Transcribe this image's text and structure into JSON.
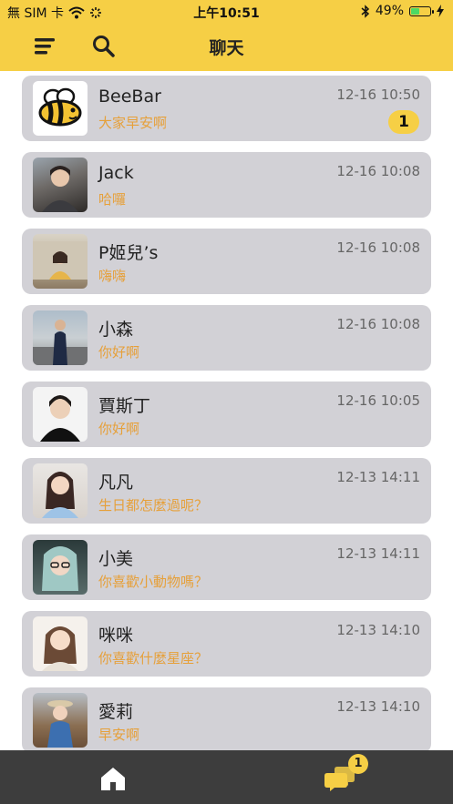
{
  "status_bar": {
    "carrier": "無 SIM 卡",
    "time": "上午10:51",
    "battery": "49%",
    "battery_level": 0.49
  },
  "header": {
    "title": "聊天",
    "menu_icon": "menu-icon",
    "search_icon": "search-icon"
  },
  "chats": [
    {
      "name": "BeeBar",
      "message": "大家早安啊",
      "time": "12-16 10:50",
      "unread": "1",
      "avatar": "bee-logo"
    },
    {
      "name": "Jack",
      "message": "哈囉",
      "time": "12-16 10:08",
      "avatar": "photo"
    },
    {
      "name": "P姬兒’s",
      "message": "嗨嗨",
      "time": "12-16 10:08",
      "avatar": "photo"
    },
    {
      "name": "小森",
      "message": "你好啊",
      "time": "12-16 10:08",
      "avatar": "photo"
    },
    {
      "name": "賈斯丁",
      "message": "你好啊",
      "time": "12-16 10:05",
      "avatar": "photo"
    },
    {
      "name": "凡凡",
      "message": "生日都怎麼過呢？",
      "time": "12-13 14:11",
      "avatar": "photo"
    },
    {
      "name": "小美",
      "message": "你喜歡小動物嗎？",
      "time": "12-13 14:11",
      "avatar": "photo"
    },
    {
      "name": "咪咪",
      "message": "你喜歡什麼星座？",
      "time": "12-13 14:10",
      "avatar": "photo"
    },
    {
      "name": "愛莉",
      "message": "早安啊",
      "time": "12-13 14:10",
      "avatar": "photo"
    }
  ],
  "tabbar": {
    "home_icon": "home-icon",
    "chat_icon": "chat-icon",
    "chat_badge": "1"
  },
  "colors": {
    "accent": "#f6cf45",
    "card_bg": "#d2d1d6",
    "message_text": "#e6a03a",
    "tabbar_bg": "#3d3d3d"
  }
}
